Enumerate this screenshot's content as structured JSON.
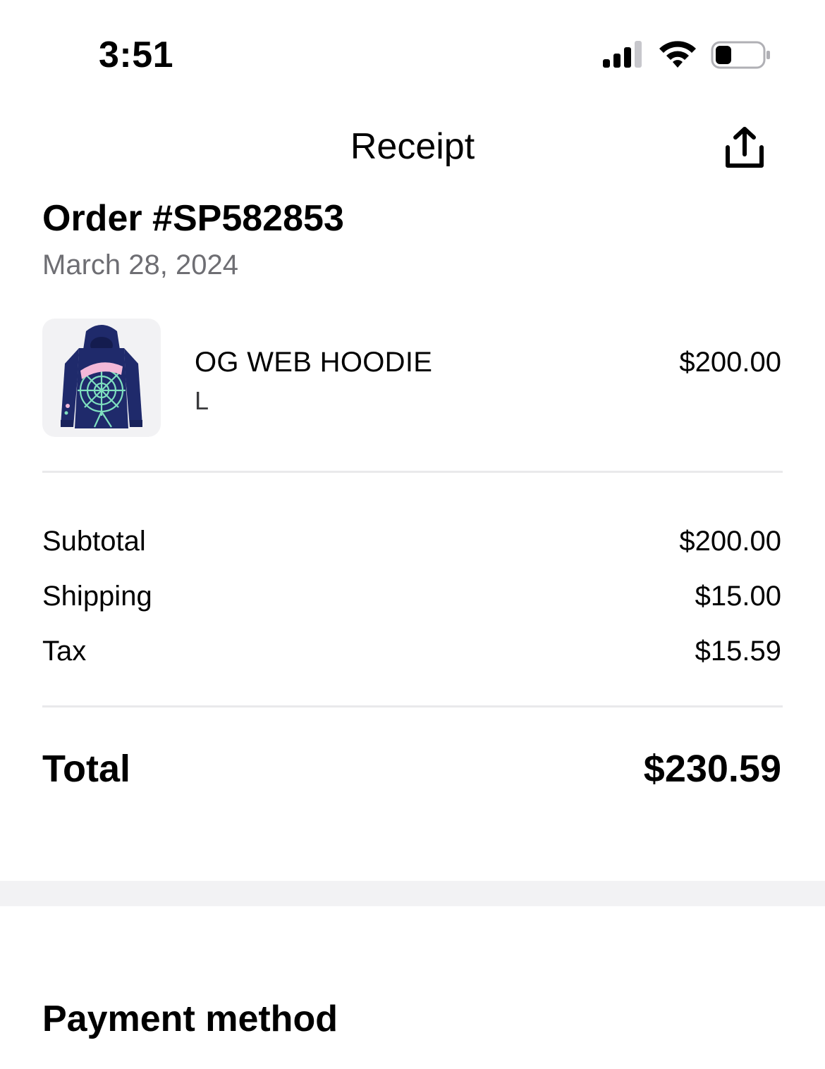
{
  "status_bar": {
    "time": "3:51",
    "signal_icon": "cellular-signal-icon",
    "wifi_icon": "wifi-icon",
    "battery_icon": "battery-icon",
    "battery_level": 0.35
  },
  "nav": {
    "title": "Receipt",
    "share_icon": "share-icon"
  },
  "order": {
    "title": "Order #SP582853",
    "date": "March 28, 2024"
  },
  "items": [
    {
      "name": "OG WEB HOODIE",
      "size": "L",
      "price": "$200.00",
      "thumbnail_icon": "hoodie-image"
    }
  ],
  "summary": {
    "subtotal_label": "Subtotal",
    "subtotal_value": "$200.00",
    "shipping_label": "Shipping",
    "shipping_value": "$15.00",
    "tax_label": "Tax",
    "tax_value": "$15.59",
    "total_label": "Total",
    "total_value": "$230.59"
  },
  "payment": {
    "title": "Payment method"
  },
  "colors": {
    "text_primary": "#000000",
    "text_secondary": "#6e6e73",
    "divider": "#e9e9eb",
    "section_gap": "#f2f2f4",
    "hoodie_navy": "#1f2a6b",
    "web_green": "#7fe0bf",
    "logo_pink": "#f3b8d8"
  }
}
